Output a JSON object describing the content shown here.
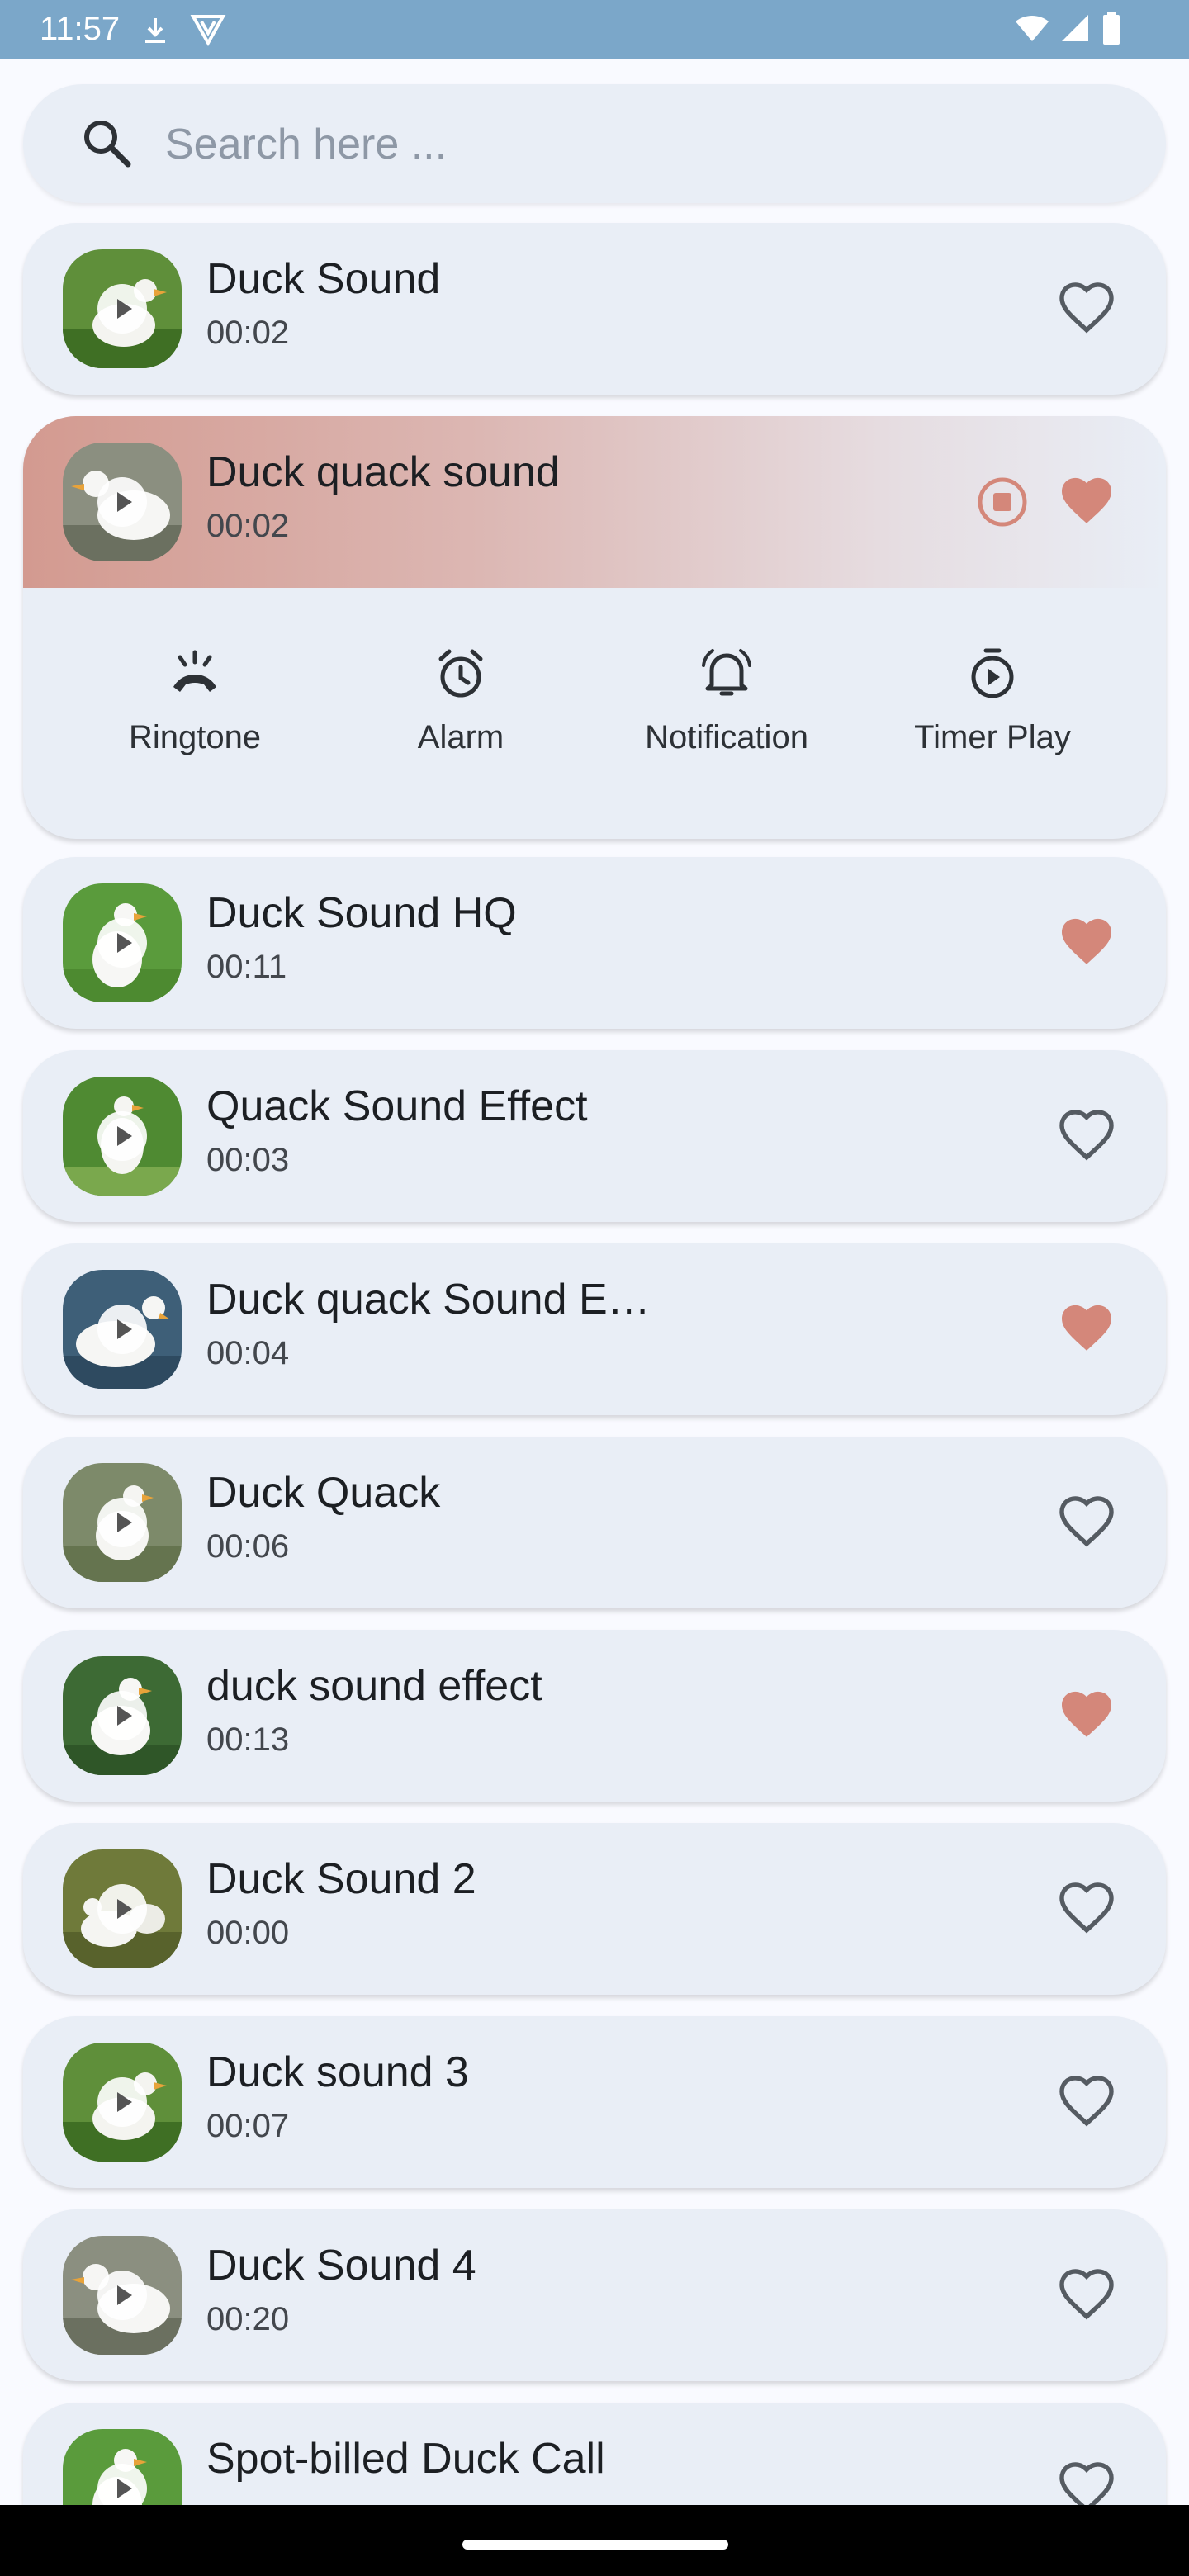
{
  "status_bar": {
    "time": "11:57"
  },
  "search": {
    "placeholder": "Search here ..."
  },
  "expanded": {
    "actions": [
      {
        "label": "Ringtone",
        "icon": "ringtone-icon"
      },
      {
        "label": "Alarm",
        "icon": "alarm-icon"
      },
      {
        "label": "Notification",
        "icon": "notification-bell-icon"
      },
      {
        "label": "Timer Play",
        "icon": "timer-icon"
      }
    ]
  },
  "sounds": [
    {
      "title": "Duck Sound",
      "duration": "00:02",
      "favorite": false
    },
    {
      "title": "Duck quack sound",
      "duration": "00:02",
      "favorite": true,
      "playing": true
    },
    {
      "title": "Duck Sound HQ",
      "duration": "00:11",
      "favorite": true
    },
    {
      "title": "Quack Sound Effect",
      "duration": "00:03",
      "favorite": false
    },
    {
      "title": "Duck quack Sound E…",
      "duration": "00:04",
      "favorite": true
    },
    {
      "title": "Duck Quack",
      "duration": "00:06",
      "favorite": false
    },
    {
      "title": "duck sound effect",
      "duration": "00:13",
      "favorite": true
    },
    {
      "title": "Duck Sound 2",
      "duration": "00:00",
      "favorite": false
    },
    {
      "title": "Duck sound 3",
      "duration": "00:07",
      "favorite": false
    },
    {
      "title": "Duck Sound 4",
      "duration": "00:20",
      "favorite": false
    },
    {
      "title": "Spot-billed Duck Call",
      "duration": "",
      "favorite": false
    }
  ],
  "colors": {
    "accent": "#d4877a",
    "card": "#e9eef6",
    "status_bar": "#7ba7c9"
  }
}
